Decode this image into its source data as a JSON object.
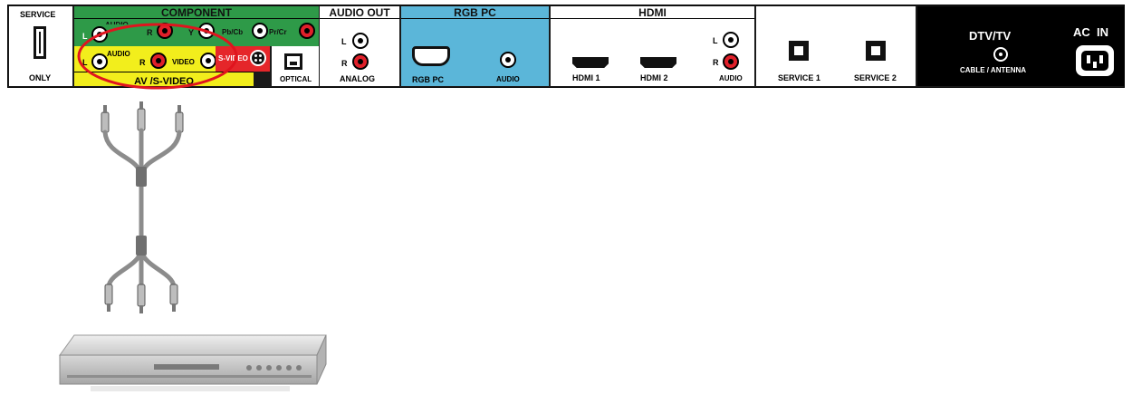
{
  "panel": {
    "service_usb": {
      "header": "SERVICE",
      "footer": "ONLY"
    },
    "component": {
      "header": "COMPONENT",
      "audio_label": "AUDIO",
      "l": "L",
      "r": "R",
      "y": "Y",
      "pb": "Pb/Cb",
      "pr": "Pr/Cr"
    },
    "av": {
      "audio_label": "AUDIO",
      "l": "L",
      "r": "R",
      "video": "VIDEO",
      "svideo": "S-VIDEO",
      "footer": "AV /S-VIDEO"
    },
    "optical": {
      "label": "OPTICAL"
    },
    "audio_out": {
      "header": "AUDIO OUT",
      "l": "L",
      "r": "R",
      "footer": "ANALOG"
    },
    "rgb_pc": {
      "header": "RGB PC",
      "port_label": "RGB PC",
      "audio_label": "AUDIO"
    },
    "hdmi": {
      "header": "HDMI",
      "port1": "HDMI 1",
      "port2": "HDMI 2",
      "l": "L",
      "r": "R",
      "audio_label": "AUDIO"
    },
    "service": {
      "port1": "SERVICE 1",
      "port2": "SERVICE 2"
    },
    "dtv": {
      "title": "DTV/TV",
      "subtitle": "CABLE / ANTENNA"
    },
    "ac": {
      "title": "AC  IN"
    }
  },
  "colors": {
    "component_green": "#2e9a48",
    "av_yellow": "#f2ee1c",
    "svideo_red": "#e5262a",
    "rgb_blue": "#5bb6d9",
    "highlight_red": "#e0141e",
    "panel_white": "#ffffff",
    "panel_black": "#000000"
  },
  "icons": {
    "cable": "rca-composite-cable-icon",
    "device": "dvd-player-icon"
  }
}
